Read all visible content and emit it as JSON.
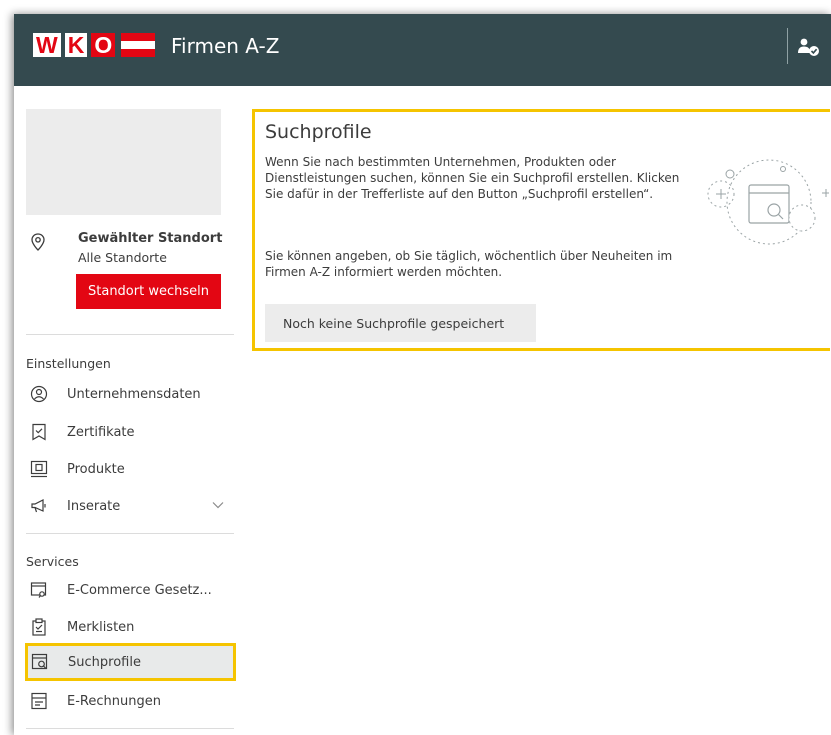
{
  "header": {
    "logo_letters": [
      "W",
      "K",
      "O"
    ],
    "app_title": "Firmen A-Z",
    "user_icon": "user-check-icon"
  },
  "sidebar": {
    "location": {
      "title": "Gewählter Standort",
      "subtitle": "Alle Standorte",
      "button_label": "Standort wechseln"
    },
    "settings_label": "Einstellungen",
    "settings_items": [
      {
        "label": "Unternehmensdaten",
        "icon": "company-profile-icon"
      },
      {
        "label": "Zertifikate",
        "icon": "certificate-icon"
      },
      {
        "label": "Produkte",
        "icon": "products-icon"
      },
      {
        "label": "Inserate",
        "icon": "megaphone-icon",
        "expandable": true
      }
    ],
    "services_label": "Services",
    "services_items": [
      {
        "label": "E-Commerce Gesetz...",
        "icon": "ecommerce-icon"
      },
      {
        "label": "Merklisten",
        "icon": "clipboard-icon"
      },
      {
        "label": "Suchprofile",
        "icon": "search-profile-icon",
        "active": true
      },
      {
        "label": "E-Rechnungen",
        "icon": "invoice-icon"
      }
    ]
  },
  "main": {
    "title": "Suchprofile",
    "paragraph1": "Wenn Sie nach bestimmten Unternehmen, Produkten oder Dienstleistungen suchen, können Sie ein Suchprofil erstellen. Klicken Sie dafür in der Trefferliste auf den Button „Suchprofil erstellen“.",
    "paragraph2": "Sie können angeben, ob Sie täglich, wöchentlich über Neuheiten im Firmen A-Z informiert werden möchten.",
    "empty_button": "Noch keine Suchprofile gespeichert"
  },
  "colors": {
    "header_bg": "#344a4f",
    "brand_red": "#e30613",
    "highlight_yellow": "#f5c400"
  }
}
